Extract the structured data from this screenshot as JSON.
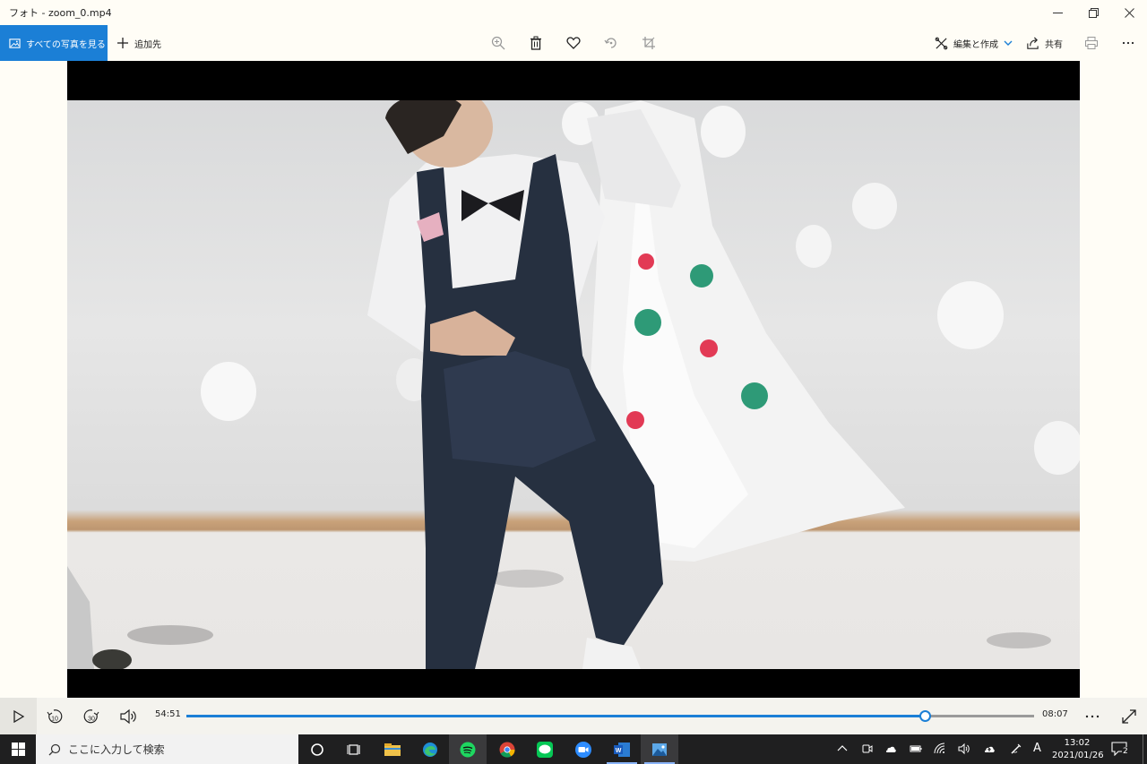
{
  "window": {
    "title": "フォト - zoom_0.mp4"
  },
  "toolbar": {
    "see_all_label": "すべての写真を見る",
    "add_to_label": "追加先",
    "edit_create_label": "編集と作成",
    "share_label": "共有"
  },
  "player": {
    "elapsed": "54:51",
    "remaining": "08:07",
    "progress": 0.871,
    "rewind_label": "10",
    "forward_label": "30"
  },
  "taskbar": {
    "search_placeholder": "ここに入力して検索",
    "time": "13:02",
    "date": "2021/01/26",
    "ime": "A",
    "notification_count": "2"
  },
  "colors": {
    "accent": "#1b7fd6",
    "taskbar": "#1f1f20",
    "app_background": "#fffdf6"
  }
}
